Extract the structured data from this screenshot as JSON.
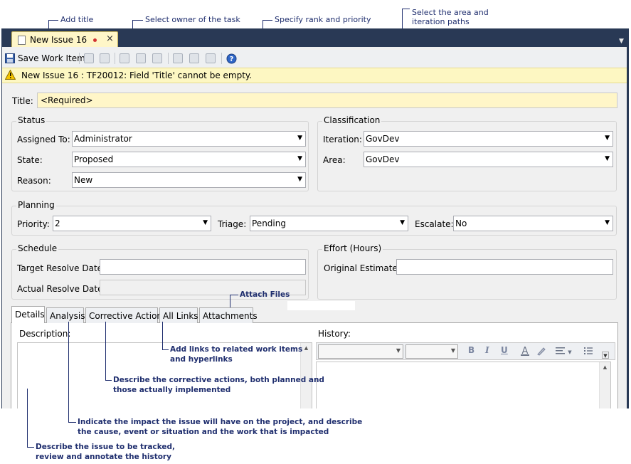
{
  "callouts": {
    "add_title": "Add title",
    "select_owner": "Select owner of the task",
    "rank_priority": "Specify rank and priority",
    "area_iteration": "Select the area and\niteration paths",
    "area_iteration_l1": "Select the area and",
    "area_iteration_l2": "iteration paths",
    "attach_files": "Attach Files",
    "add_links_l1": "Add links to related work items",
    "add_links_l2": "and hyperlinks",
    "corrective_l1": "Describe the corrective actions, both planned and",
    "corrective_l2": "those actually implemented",
    "impact_l1": "Indicate the impact the issue will have on the project, and describe",
    "impact_l2": "the cause, event or situation and the work that is impacted",
    "describe_l1": "Describe the issue to be tracked,",
    "describe_l2": "review and annotate the history"
  },
  "document_tab": {
    "title": "New Issue 16",
    "close": "×"
  },
  "toolbar": {
    "save_label": "Save Work Item"
  },
  "warning": {
    "text": "New Issue 16 : TF20012: Field 'Title' cannot be empty."
  },
  "title_field": {
    "label": "Title:",
    "value": "<Required>"
  },
  "status": {
    "group_title": "Status",
    "assigned_to": {
      "label": "Assigned To:",
      "value": "Administrator"
    },
    "state": {
      "label": "State:",
      "value": "Proposed"
    },
    "reason": {
      "label": "Reason:",
      "value": "New"
    }
  },
  "classification": {
    "group_title": "Classification",
    "iteration": {
      "label": "Iteration:",
      "value": "GovDev"
    },
    "area": {
      "label": "Area:",
      "value": "GovDev"
    }
  },
  "planning": {
    "group_title": "Planning",
    "priority": {
      "label": "Priority:",
      "value": "2"
    },
    "triage": {
      "label": "Triage:",
      "value": "Pending"
    },
    "escalate": {
      "label": "Escalate:",
      "value": "No"
    }
  },
  "schedule": {
    "group_title": "Schedule",
    "target_resolve": {
      "label": "Target Resolve Date:",
      "value": ""
    },
    "actual_resolve": {
      "label": "Actual Resolve Date:",
      "value": ""
    }
  },
  "effort": {
    "group_title": "Effort (Hours)",
    "original_estimate": {
      "label": "Original Estimate:",
      "value": ""
    }
  },
  "tabs": [
    {
      "label": "Details"
    },
    {
      "label": "Analysis"
    },
    {
      "label": "Corrective Action"
    },
    {
      "label": "All Links"
    },
    {
      "label": "Attachments"
    }
  ],
  "details": {
    "description_label": "Description:",
    "history_label": "History:"
  },
  "history_toolbar": {
    "bold": "B",
    "italic": "I",
    "underline": "U"
  },
  "colors": {
    "frame": "#293955",
    "tab_active": "#fff6c8",
    "warning_bg": "#fdf7c2",
    "callout_text": "#1f2e6e"
  }
}
